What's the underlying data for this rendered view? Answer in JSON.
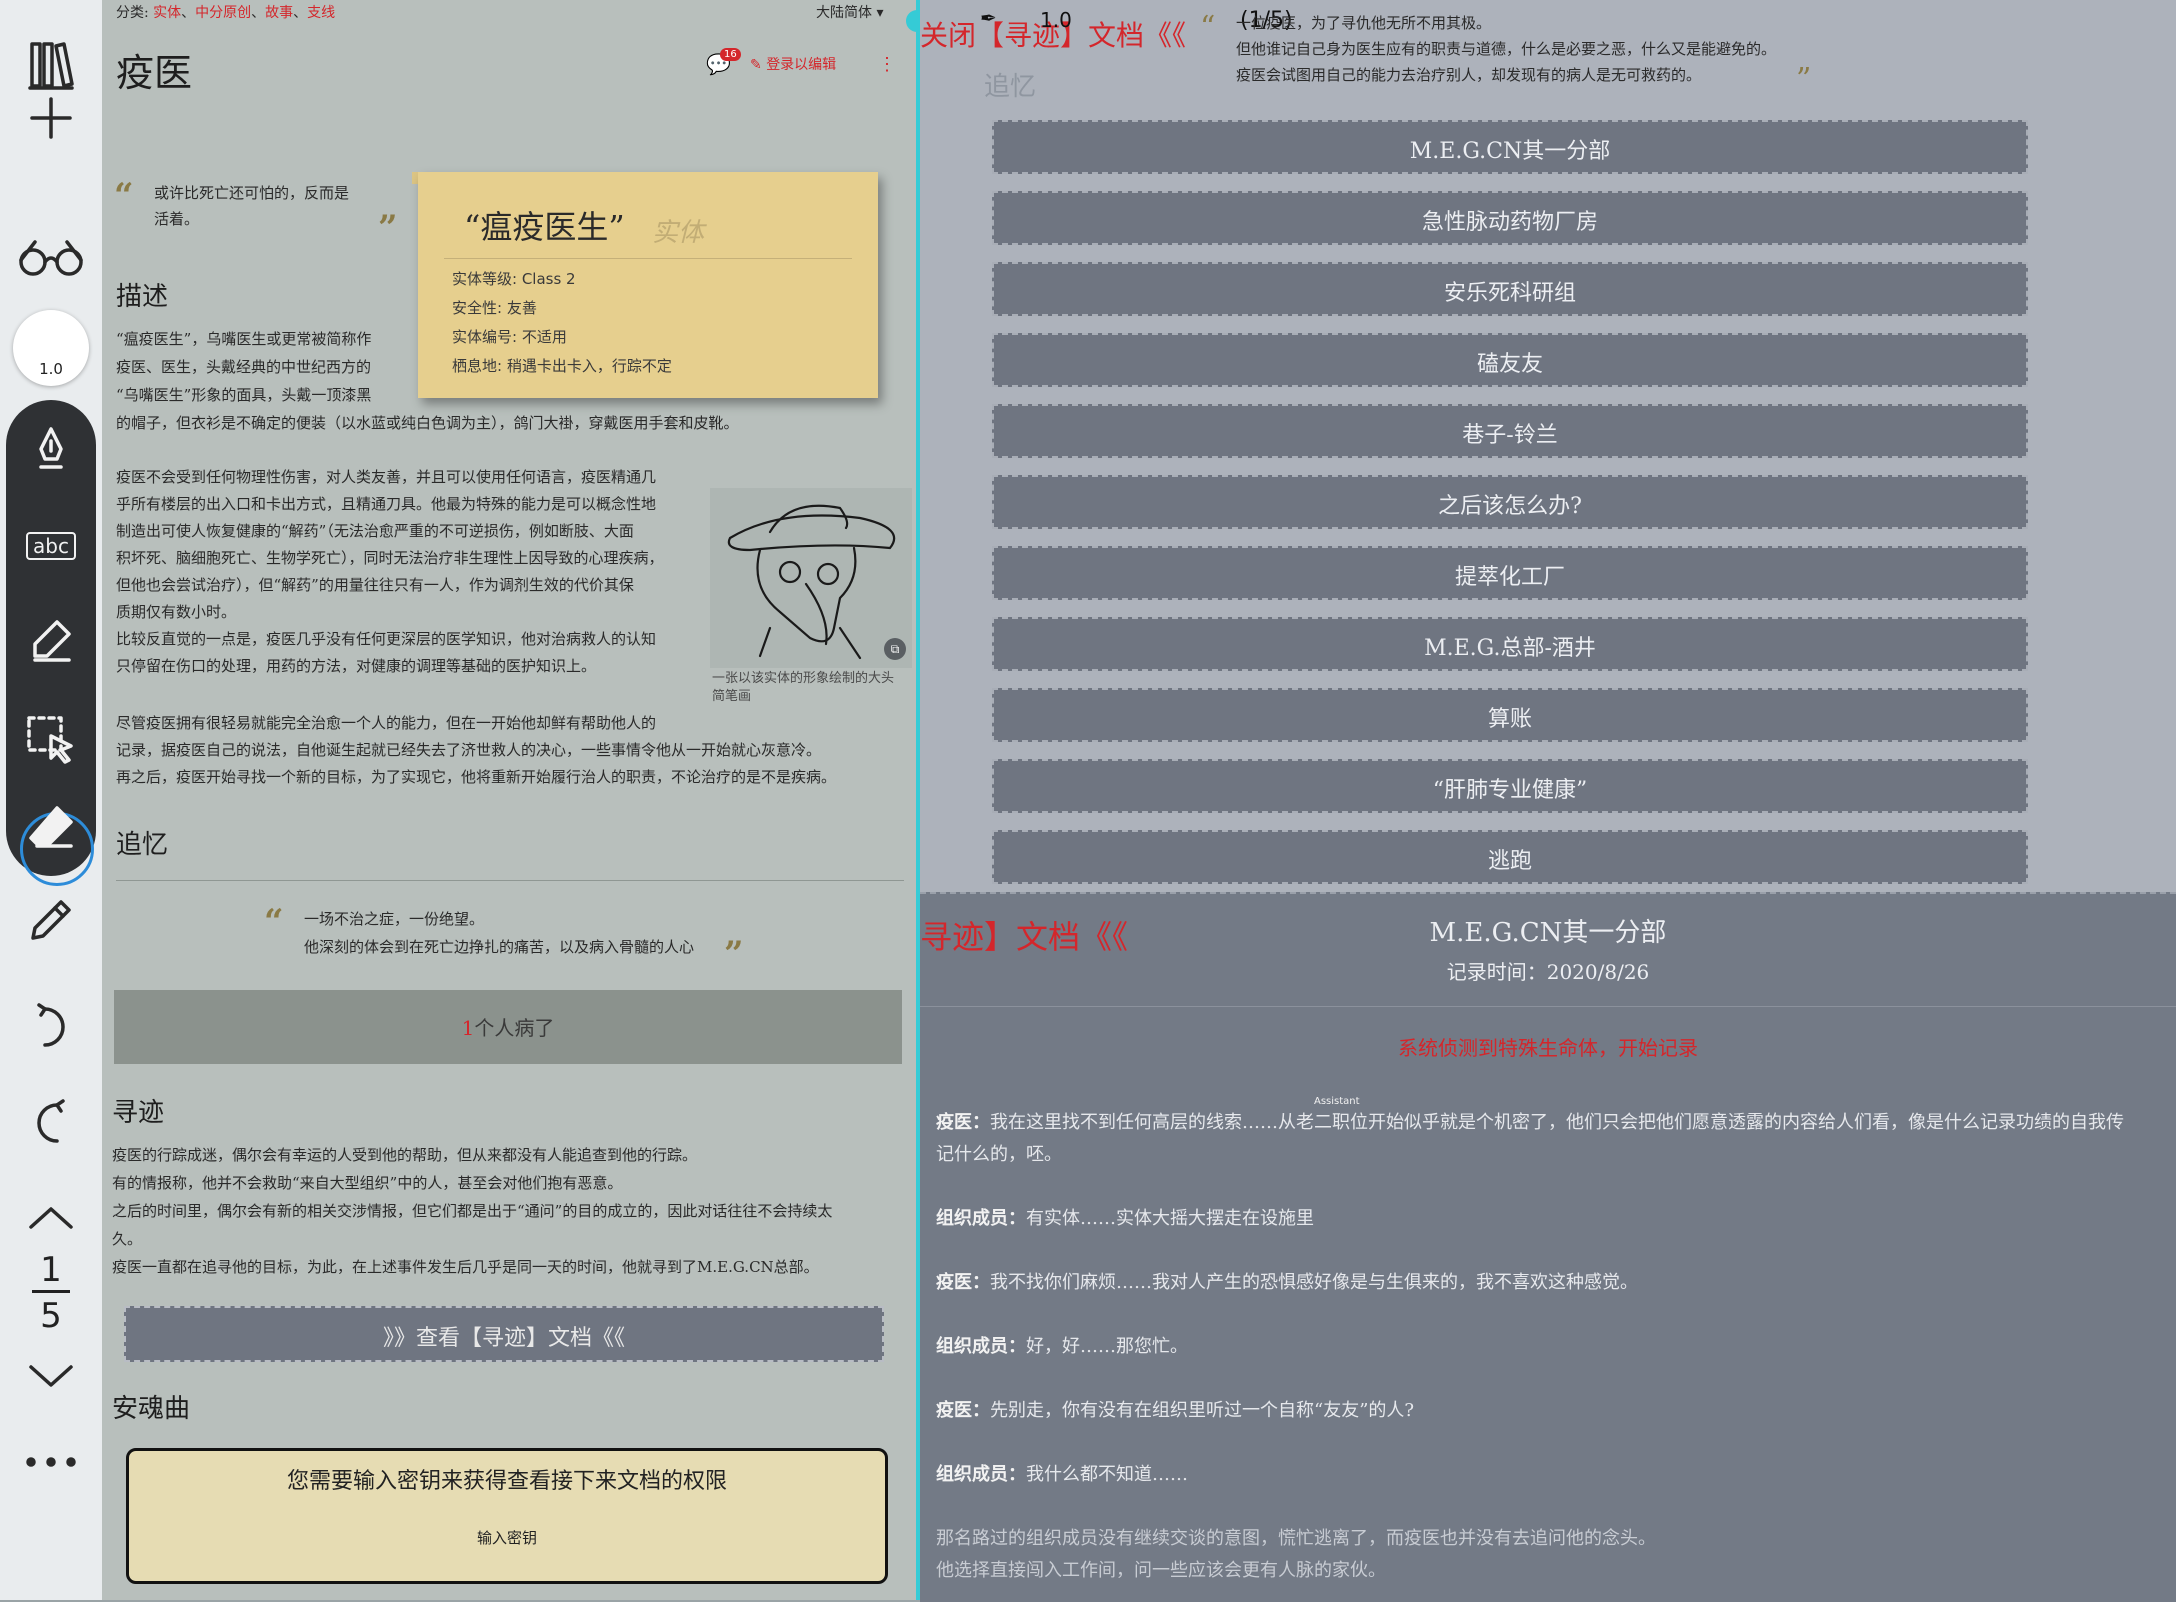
{
  "toolbar": {
    "zoom_label": "1.0",
    "pen_label": "abc",
    "current_page": "1",
    "total_pages": "5"
  },
  "left_doc": {
    "category_prefix": "分类:",
    "categories": [
      "实体",
      "中分原创",
      "故事",
      "支线"
    ],
    "language": "大陆简体",
    "title": "疫医",
    "comment_count": "16",
    "login_edit": "登录以编辑",
    "epigraph_1": "或许比死亡还可怕的，反而是",
    "epigraph_2": "活着。",
    "card": {
      "title": "“瘟疫医生”",
      "tag": "实体",
      "rows": [
        "实体等级: Class 2",
        "安全性: 友善",
        "实体编号: 不适用",
        "栖息地: 稍遇卡出卡入，行踪不定"
      ]
    },
    "section_desc": "描述",
    "desc_1": [
      "“瘟疫医生”，乌嘴医生或更常被简称作",
      "疫医、医生，头戴经典的中世纪西方的",
      "“乌嘴医生”形象的面具，头戴一顶漆黑",
      "的帽子，但衣衫是不确定的便装（以水蓝或纯白色调为主），鸽门大褂，穿戴医用手套和皮靴。"
    ],
    "desc_2": [
      "疫医不会受到任何物理性伤害，对人类友善，并且可以使用任何语言，疫医精通几",
      "乎所有楼层的出入口和卡出方式，且精通刀具。他最为特殊的能力是可以概念性地",
      "制造出可使人恢复健康的“解药”（无法治愈严重的不可逆损伤，例如断肢、大面",
      "积坏死、脑细胞死亡、生物学死亡），同时无法治疗非生理性上因导致的心理疾病，",
      "但他也会尝试治疗），但“解药”的用量往往只有一人，作为调剂生效的代价其保",
      "质期仅有数小时。",
      "比较反直觉的一点是，疫医几乎没有任何更深层的医学知识，他对治病救人的认知",
      "只停留在伤口的处理，用药的方法，对健康的调理等基础的医护知识上。"
    ],
    "desc_3": [
      "尽管疫医拥有很轻易就能完全治愈一个人的能力，但在一开始他却鲜有帮助他人的",
      "记录，据疫医自己的说法，自他诞生起就已经失去了济世救人的决心，一些事情令他从一开始就心灰意冷。",
      "再之后，疫医开始寻找一个新的目标，为了实现它，他将重新开始履行治人的职责，不论治疗的是不是疾病。"
    ],
    "sketch_caption_1": "一张以该实体的形象绘制的大头",
    "sketch_caption_2": "简笔画",
    "section_memory": "追忆",
    "memory_1": "一场不治之症，一份绝望。",
    "memory_2": "他深刻的体会到在死亡边挣扎的痛苦，以及病入骨髓的人心",
    "sick_count": "1",
    "sick_text": "个人病了",
    "section_trace": "寻迹",
    "trace": [
      "疫医的行踪成迷，偶尔会有幸运的人受到他的帮助，但从来都没有人能追查到他的行踪。",
      "有的情报称，他并不会救助“来自大型组织”中的人，甚至会对他们抱有恶意。",
      "之后的时间里，偶尔会有新的相关交涉情报，但它们都是出于“通问”的目的成立的，因此对话往往不会持续太",
      "久。",
      "疫医一直都在追寻他的目标，为此，在上述事件发生后几乎是同一天的时间，他就寻到了M.E.G.CN总部。"
    ],
    "view_doc": "》》查看【寻迹】文档《《",
    "section_requiem": "安魂曲",
    "key_prompt": "您需要输入密钥来获得查看接下来文档的权限",
    "key_input": "输入密钥"
  },
  "right_top": {
    "header_fragment": "关闭【寻迹】文档《《",
    "zoom": "1.0",
    "page_indicator": "(1/5)",
    "quote_1": "一位疫医，为了寻仇他无所不用其极。",
    "quote_2": "但他谁记自己身为医生应有的职责与道德，什么是必要之恶，什么又是能避免的。",
    "quote_3": "疫医会试图用自己的能力去治疗别人，却发现有的病人是无可救药的。",
    "faded_heading": "追忆",
    "menu": [
      "M.E.G.CN其一分部",
      "急性脉动药物厂房",
      "安乐死科研组",
      "磕友友",
      "巷子-铃兰",
      "之后该怎么办?",
      "提萃化工厂",
      "M.E.G.总部-酒井",
      "算账",
      "“肝肺专业健康”",
      "逃跑"
    ]
  },
  "right_bottom": {
    "header_fragment": "寻迹】文档《《",
    "title": "M.E.G.CN其一分部",
    "date": "记录时间：2020/8/26",
    "system_notice": "系统侦测到特殊生命体，开始记录",
    "assistant_tag": "Assistant",
    "lines": [
      {
        "speaker": "疫医：",
        "text": "我在这里找不到任何高层的线索……从老二职位开始似乎就是个机密了，他们只会把他们愿意透露的内容给人们看，像是什么记录功绩的自我传"
      },
      {
        "speaker": "",
        "text": "记什么的，呸。"
      },
      {
        "speaker": "组织成员：",
        "text": "有实体……实体大摇大摆走在设施里"
      },
      {
        "speaker": "疫医：",
        "text": "我不找你们麻烦……我对人产生的恐惧感好像是与生俱来的，我不喜欢这种感觉。"
      },
      {
        "speaker": "组织成员：",
        "text": "好，好……那您忙。"
      },
      {
        "speaker": "疫医：",
        "text": "先别走，你有没有在组织里听过一个自称“友友”的人?"
      },
      {
        "speaker": "组织成员：",
        "text": "我什么都不知道……"
      }
    ],
    "narration_1": "那名路过的组织成员没有继续交谈的意图，慌忙逃离了，而疫医也并没有去追问他的念头。",
    "narration_2": "他选择直接闯入工作间，问一些应该会更有人脉的家伙。"
  },
  "colors": {
    "accent_red": "#d4262b",
    "divider": "#35cbd6",
    "card": "#e6cf8e",
    "button": "#6f7581"
  }
}
